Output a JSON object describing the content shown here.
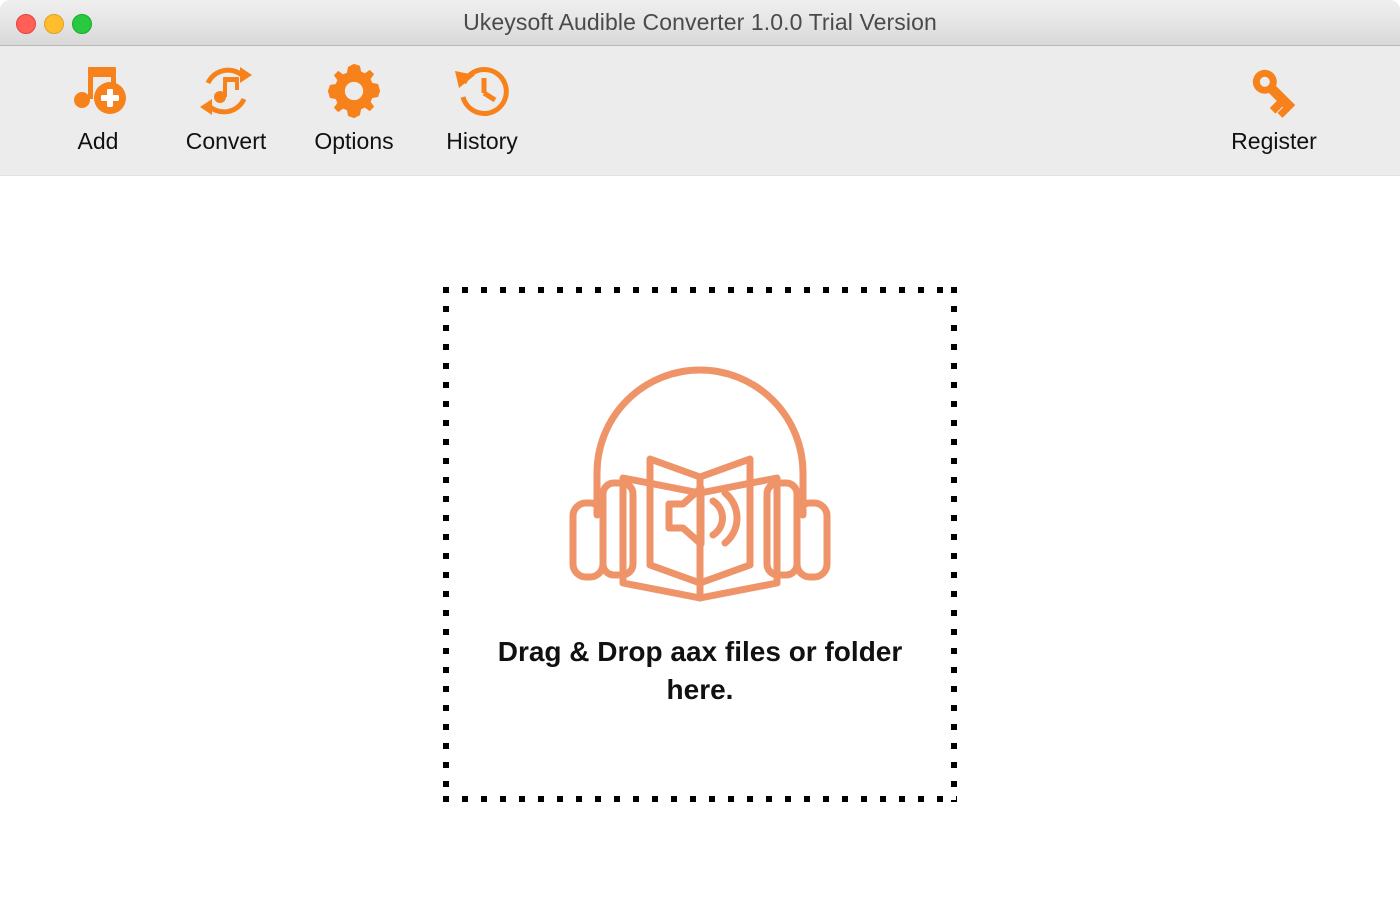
{
  "window": {
    "title": "Ukeysoft Audible Converter 1.0.0 Trial Version",
    "controls": {
      "close_label": "Close",
      "minimize_label": "Minimize",
      "maximize_label": "Maximize"
    }
  },
  "toolbar": {
    "left_items": [
      {
        "label": "Add",
        "icon": "music-note-add-icon"
      },
      {
        "label": "Convert",
        "icon": "convert-refresh-music-icon"
      },
      {
        "label": "Options",
        "icon": "gear-icon"
      },
      {
        "label": "History",
        "icon": "clock-history-icon"
      }
    ],
    "right_items": [
      {
        "label": "Register",
        "icon": "key-icon"
      }
    ]
  },
  "drop_zone": {
    "message_line1": "Drag & Drop aax files or",
    "message_line2": "folder here.",
    "icon": "audiobook-headphones-icon"
  },
  "colors": {
    "accent_orange": "#F7821B",
    "icon_salmon": "#EE9468",
    "titlebar_text": "#4A4A4A",
    "toolbar_bg": "#ECECEC",
    "content_bg": "#FFFFFF",
    "dash_border": "#000000",
    "traffic_close": "#FF5F57",
    "traffic_min": "#FFBD2E",
    "traffic_max": "#28C840"
  }
}
